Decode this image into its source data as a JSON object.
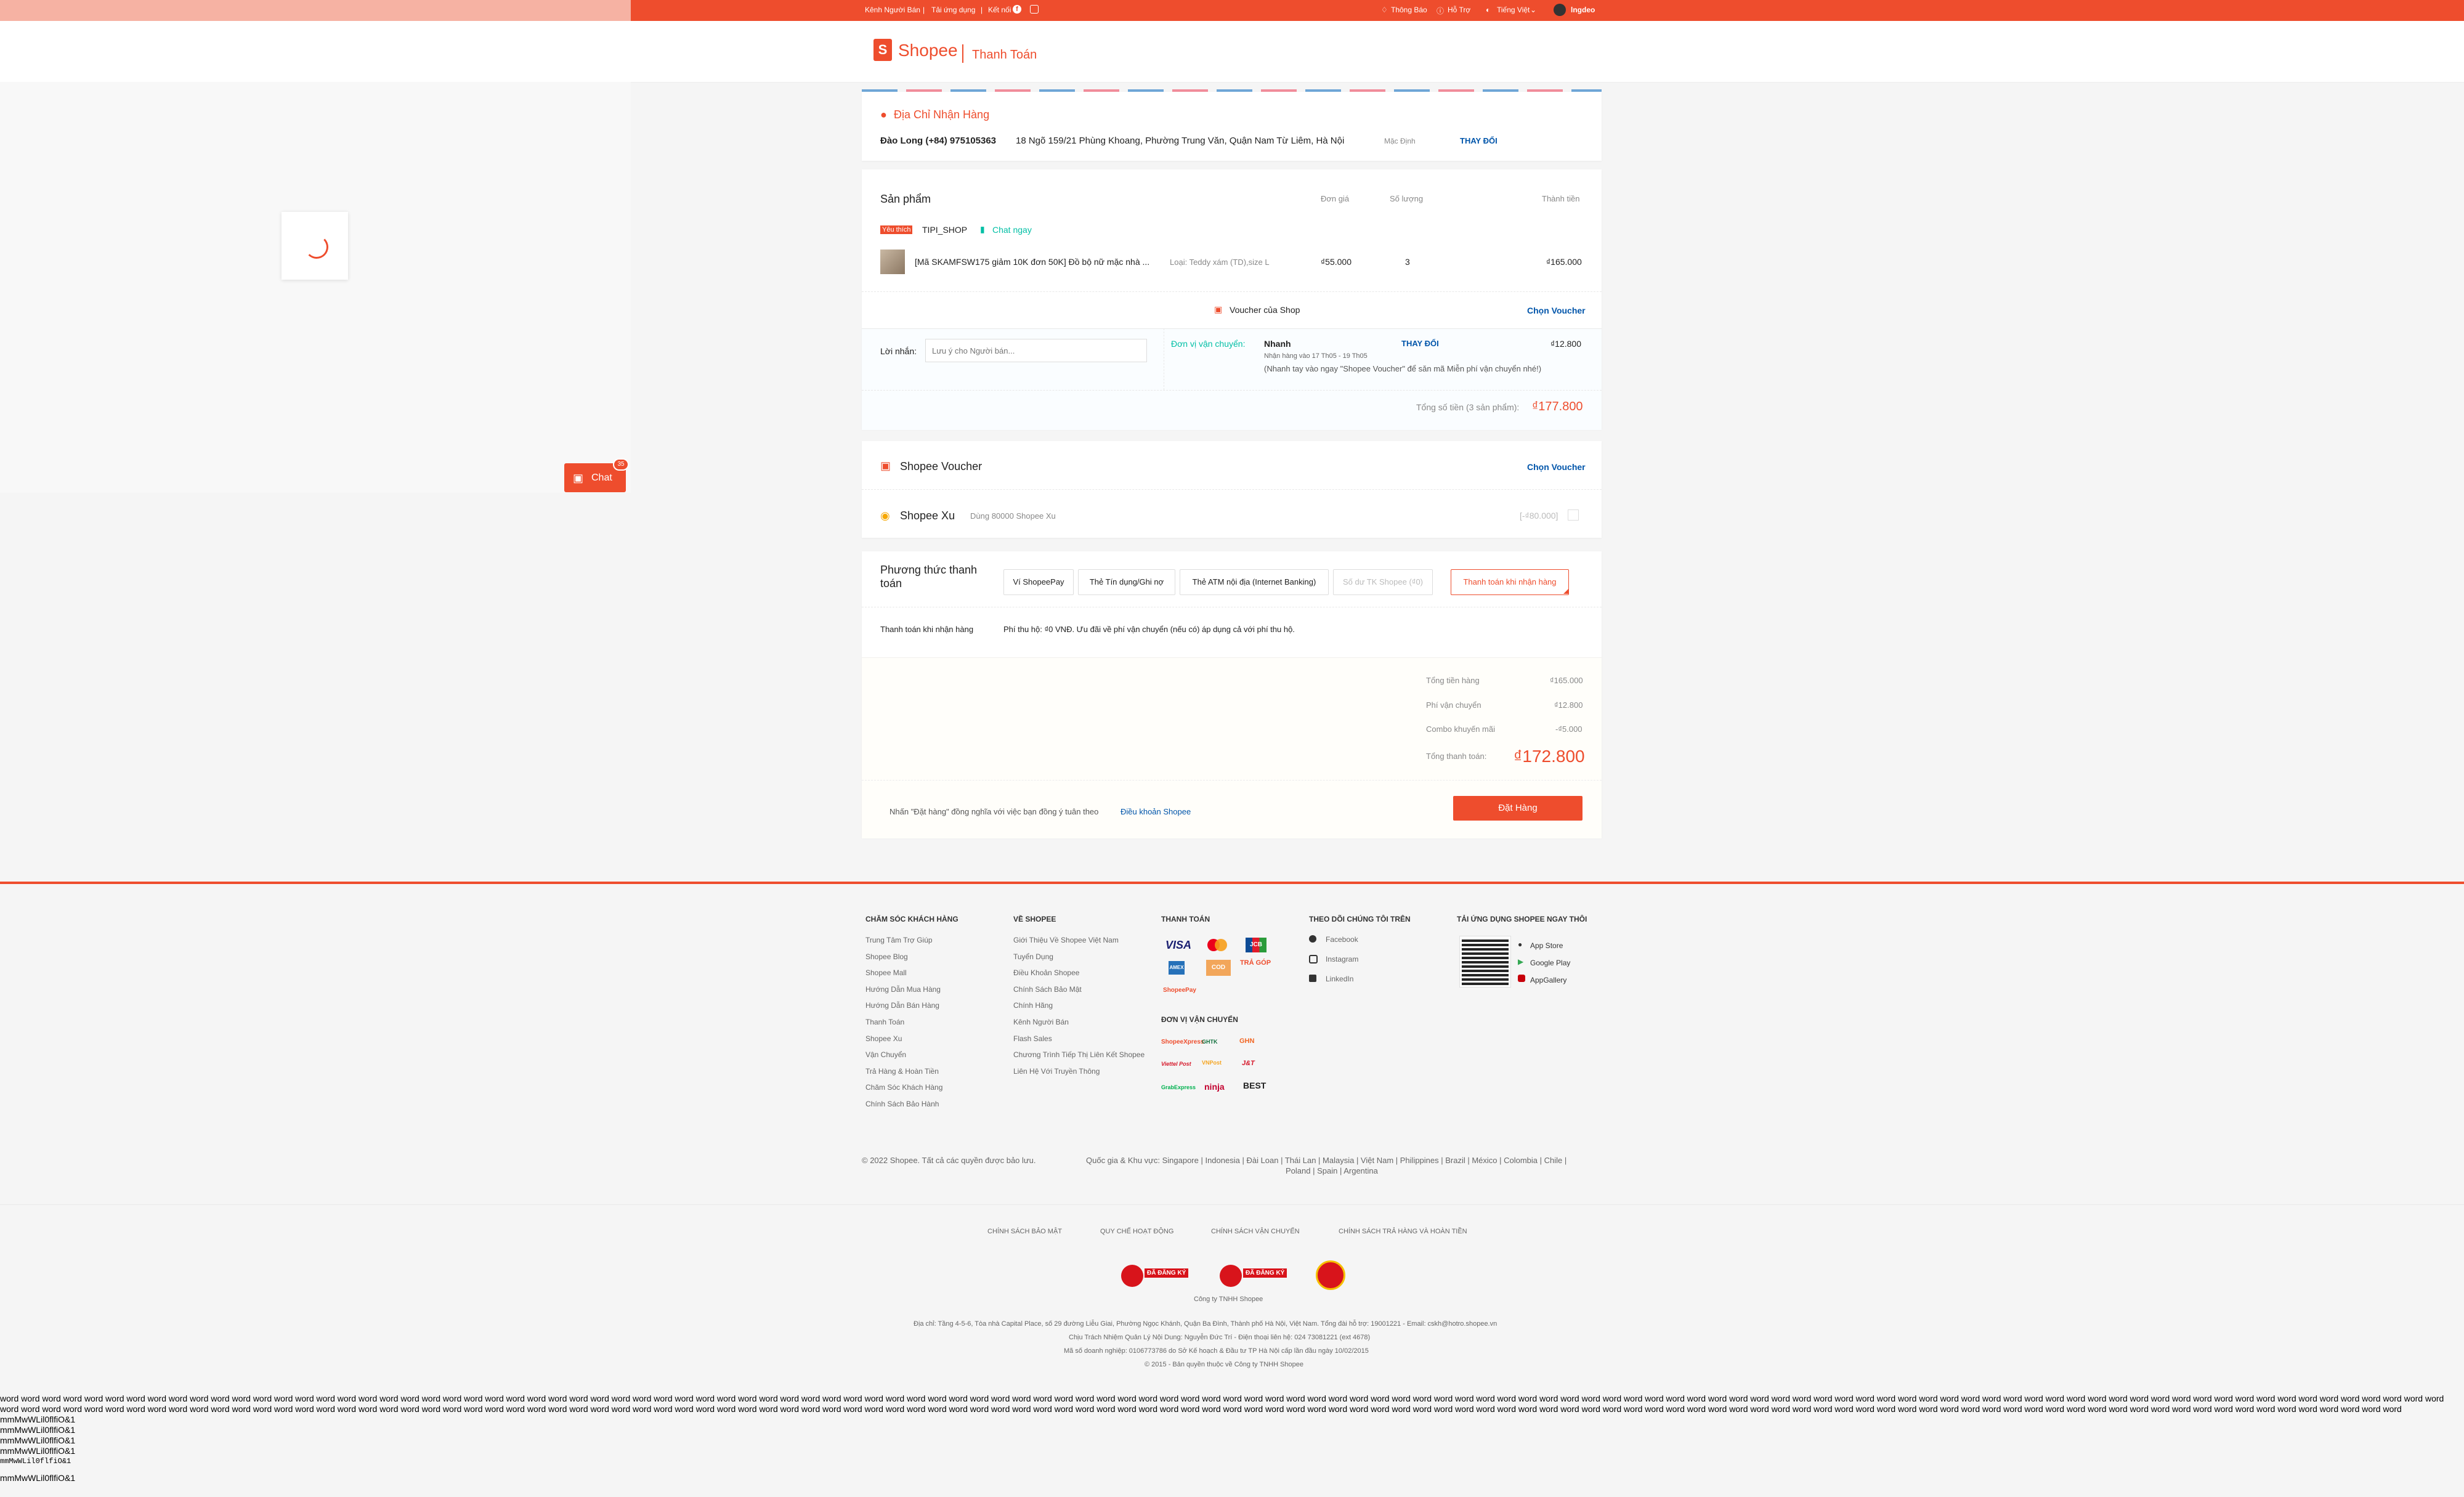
{
  "topbar": {
    "seller_channel": "Kênh Người Bán",
    "download_app": "Tải ứng dụng",
    "connect": "Kết nối",
    "notifications": "Thông Báo",
    "support": "Hỗ Trợ",
    "language": "Tiếng Việt",
    "username": "lngdeo"
  },
  "header": {
    "logo_text": "Shopee",
    "page_title": "Thanh Toán"
  },
  "chat": {
    "label": "Chat",
    "badge": "35"
  },
  "address": {
    "section_title": "Địa Chỉ Nhận Hàng",
    "name_phone": "Đào Long (+84) 975105363",
    "address": "18 Ngõ 159/21 Phùng Khoang, Phường Trung Văn, Quận Nam Từ Liêm, Hà Nội",
    "default_label": "Mặc Định",
    "change_label": "THAY ĐỔI"
  },
  "products": {
    "section_title": "Sản phẩm",
    "col_unit_price": "Đơn giá",
    "col_quantity": "Số lượng",
    "col_total": "Thành tiền",
    "shop_badge": "Yêu thích",
    "shop_name": "TIPI_SHOP",
    "chat_now": "Chat ngay",
    "items": [
      {
        "name": "[Mã SKAMFSW175 giảm 10K đơn 50K] Đồ bộ nữ mặc nhà ...",
        "variant": "Loại: Teddy xám (TD),size L",
        "unit_price": "₫55.000",
        "quantity": "3",
        "total": "₫165.000"
      }
    ],
    "shop_voucher_label": "Voucher của Shop",
    "choose_voucher": "Chọn Voucher",
    "message_label": "Lời nhắn:",
    "message_placeholder": "Lưu ý cho Người bán...",
    "shipping_label": "Đơn vị vận chuyển:",
    "shipping_method": "Nhanh",
    "shipping_change": "THAY ĐỔI",
    "shipping_fee": "₫12.800",
    "shipping_eta": "Nhận hàng vào 17 Th05 - 19 Th05",
    "shipping_note": "(Nhanh tay vào ngay \"Shopee Voucher\" để săn mã Miễn phí vận chuyển nhé!)",
    "subtotal_label": "Tổng số tiền (3 sản phẩm):",
    "subtotal_value": "₫177.800"
  },
  "platform_voucher": {
    "label": "Shopee Voucher",
    "choose": "Chọn Voucher",
    "coins_label": "Shopee Xu",
    "coins_desc": "Dùng 80000 Shopee Xu",
    "coins_value": "[-₫80.000]"
  },
  "payment": {
    "section_title_1": "Phương thức thanh",
    "section_title_2": "toán",
    "methods": [
      "Ví ShopeePay",
      "Thẻ Tín dụng/Ghi nợ",
      "Thẻ ATM nội địa (Internet Banking)",
      "Số dư TK Shopee (₫0)",
      "Thanh toán khi nhận hàng"
    ],
    "selected_label": "Thanh toán khi nhận hàng",
    "selected_desc": "Phí thu hộ: ₫0 VNĐ. Ưu đãi về phí vận chuyển (nếu có) áp dụng cả với phí thu hộ."
  },
  "summary": {
    "merch_label": "Tổng tiền hàng",
    "merch_value": "₫165.000",
    "ship_label": "Phí vận chuyển",
    "ship_value": "₫12.800",
    "combo_label": "Combo khuyến mãi",
    "combo_value": "-₫5.000",
    "total_label": "Tổng thanh toán:",
    "total_value": "₫172.800",
    "terms_text": "Nhấn \"Đặt hàng\" đồng nghĩa với việc bạn đồng ý tuân theo",
    "terms_link": "Điều khoản Shopee",
    "place_order": "Đặt Hàng"
  },
  "footer": {
    "cs_title": "CHĂM SÓC KHÁCH HÀNG",
    "cs_links": [
      "Trung Tâm Trợ Giúp",
      "Shopee Blog",
      "Shopee Mall",
      "Hướng Dẫn Mua Hàng",
      "Hướng Dẫn Bán Hàng",
      "Thanh Toán",
      "Shopee Xu",
      "Vận Chuyển",
      "Trả Hàng & Hoàn Tiền",
      "Chăm Sóc Khách Hàng",
      "Chính Sách Bảo Hành"
    ],
    "about_title": "VỀ SHOPEE",
    "about_links": [
      "Giới Thiệu Về Shopee Việt Nam",
      "Tuyển Dụng",
      "Điều Khoản Shopee",
      "Chính Sách Bảo Mật",
      "Chính Hãng",
      "Kênh Người Bán",
      "Flash Sales",
      "Chương Trình Tiếp Thị Liên Kết Shopee",
      "Liên Hệ Với Truyền Thông"
    ],
    "payment_title": "THANH TOÁN",
    "payment_logos": [
      "VISA",
      "MC",
      "JCB",
      "AMEX",
      "COD",
      "TRẢ GÓP",
      "ShopeePay"
    ],
    "shipping_title": "ĐƠN VỊ VẬN CHUYỂN",
    "shipping_logos": [
      "ShopeeXpress",
      "GHTK",
      "GHN",
      "Viettel Post",
      "VNPost",
      "J&T",
      "GrabExpress",
      "ninja",
      "BEST"
    ],
    "follow_title": "THEO DÕI CHÚNG TÔI TRÊN",
    "follow_links": [
      "Facebook",
      "Instagram",
      "LinkedIn"
    ],
    "app_title": "TẢI ỨNG DỤNG SHOPEE NGAY THÔI",
    "app_stores": [
      "App Store",
      "Google Play",
      "AppGallery"
    ],
    "copyright": "© 2022 Shopee. Tất cả các quyền được bảo lưu.",
    "countries_1": "Quốc gia & Khu vực: Singapore | Indonesia | Đài Loan | Thái Lan | Malaysia | Việt Nam | Philippines | Brazil | México | Colombia | Chile |",
    "countries_2": "Poland | Spain | Argentina",
    "policies": [
      "CHÍNH SÁCH BẢO MẬT",
      "QUY CHẾ HOẠT ĐỘNG",
      "CHÍNH SÁCH VẬN CHUYỂN",
      "CHÍNH SÁCH TRẢ HÀNG VÀ HOÀN TIỀN"
    ],
    "badge_text": "ĐÃ ĐĂNG KÝ",
    "company": "Công ty TNHH Shopee",
    "address_line": "Địa chỉ: Tầng 4-5-6, Tòa nhà Capital Place, số 29 đường Liễu Giai, Phường Ngọc Khánh, Quận Ba Đình, Thành phố Hà Nội, Việt Nam. Tổng đài hỗ trợ: 19001221 - Email: cskh@hotro.shopee.vn",
    "responsible_line": "Chịu Trách Nhiệm Quản Lý Nội Dung: Nguyễn Đức Trí - Điện thoại liên hệ: 024 73081221 (ext 4678)",
    "business_line": "Mã số doanh nghiệp: 0106773786 do Sở Kế hoạch & Đầu tư TP Hà Nội cấp lần đầu ngày 10/02/2015",
    "rights_line": "© 2015 - Bản quyền thuộc về Công ty TNHH Shopee"
  },
  "debug": {
    "words": "word word word word word word word word word word word word word word word word word word word word word word word word word word word word word word word word word word word word word word word word word word word word word word word word word word word word word word word word word word word word word word word word word word word word word word word word word word word word word word word word word word word word word word word word word word word word word word word word word word word word word word word word word word word word word word word word word word word word word word word word word word word word word word word word word word word word word word word word word word word word word word word word word word word word word word word word word word word word word word word word word word word word word word word word word word word word word word word word word word word word word word word word word word word word word word word word word word word word word word word word word word word word word word word word word word word word word word word word word word word word word word word word word word word word word word",
    "samples": [
      "mmMwWLil0flfiO&1",
      "mmMwWLil0flfiO&1",
      "mmMwWLil0flfiO&1",
      "mmMwWLil0flfiO&1",
      "mmMwWLil0flfiO&1",
      "mmMwWLil0flfiO&1"
    ]
  },
  "colors": {
    "brand": "#ee4d2d",
    "link": "#0055aa",
    "teal": "#00bfa5"
  }
}
